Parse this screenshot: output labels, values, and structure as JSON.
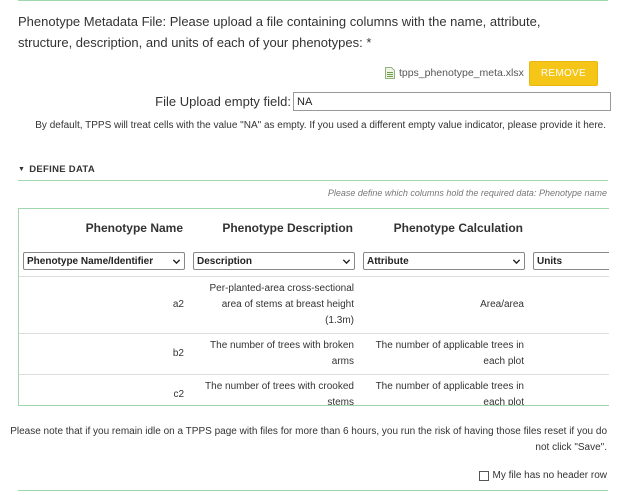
{
  "metadata_file": {
    "label": "Phenotype Metadata File: Please upload a file containing columns with the name, attribute, structure, description, and units of each of your phenotypes: *",
    "file_name": "tpps_phenotype_meta.xlsx",
    "remove_label": "REMOVE",
    "empty_field_label": "File Upload empty field:",
    "empty_field_value": "NA",
    "empty_field_help": "By default, TPPS will treat cells with the value \"NA\" as empty. If you used a different empty value indicator, please provide it here."
  },
  "define_data": {
    "header": "DEFINE DATA",
    "help": "Please define which columns hold the required data: Phenotype name",
    "columns": [
      {
        "header": "Phenotype Name",
        "selected": "Phenotype Name/Identifier"
      },
      {
        "header": "Phenotype Description",
        "selected": "Description"
      },
      {
        "header": "Phenotype Calculation",
        "selected": "Attribute"
      },
      {
        "header": "",
        "selected": "Units"
      }
    ],
    "rows": [
      {
        "name": "a2",
        "description": "Per-planted-area cross-sectional area of stems at breast height (1.3m)",
        "calculation": "Area/area"
      },
      {
        "name": "b2",
        "description": "The number of trees with broken arms",
        "calculation": "The number of applicable trees in each plot"
      },
      {
        "name": "c2",
        "description": "The number of trees with crooked stems",
        "calculation": "The number of applicable trees in each plot"
      }
    ]
  },
  "idle_note": "Please note that if you remain idle on a TPPS page with files for more than 6 hours, you run the risk of having those files reset if you do not click \"Save\".",
  "no_header_label": "My file has no header row",
  "colors": {
    "accent_rule": "#9fd6ad",
    "remove_button": "#f5c518"
  }
}
